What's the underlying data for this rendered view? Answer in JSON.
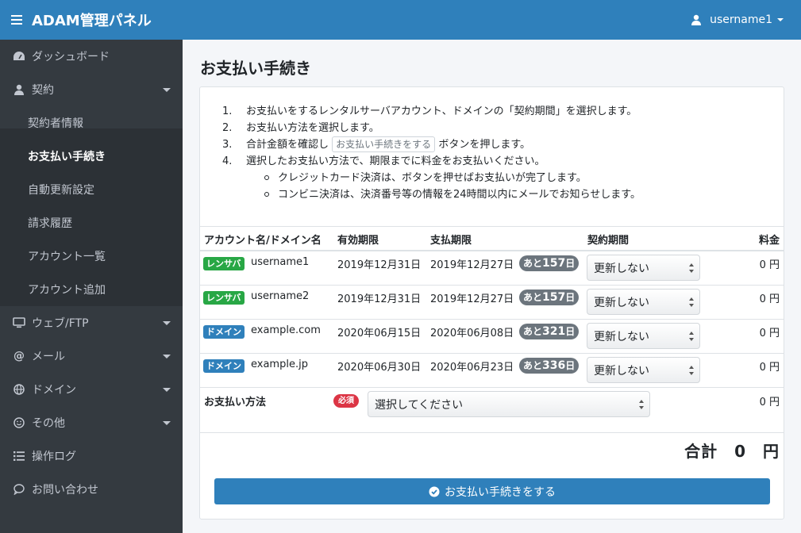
{
  "header": {
    "title": "ADAM管理パネル",
    "username": "username1"
  },
  "sidebar": {
    "items": [
      {
        "label": "ダッシュボード",
        "icon": "dashboard-icon"
      },
      {
        "label": "契約",
        "icon": "user-icon"
      },
      {
        "label": "契約者情報"
      },
      {
        "label": "お支払い手続き"
      },
      {
        "label": "自動更新設定"
      },
      {
        "label": "請求履歴"
      },
      {
        "label": "アカウント一覧"
      },
      {
        "label": "アカウント追加"
      },
      {
        "label": "ウェブ/FTP",
        "icon": "desktop-icon"
      },
      {
        "label": "メール",
        "icon": "at-icon"
      },
      {
        "label": "ドメイン",
        "icon": "globe-icon"
      },
      {
        "label": "その他",
        "icon": "smile-icon"
      },
      {
        "label": "操作ログ",
        "icon": "list-icon"
      },
      {
        "label": "お問い合わせ",
        "icon": "comment-icon"
      }
    ]
  },
  "page": {
    "title": "お支払い手続き"
  },
  "instructions": {
    "s1_num": "1.",
    "s1": "お支払いをするレンタルサーバアカウント、ドメインの「契約期間」を選択します。",
    "s2_num": "2.",
    "s2": "お支払い方法を選択します。",
    "s3_num": "3.",
    "s3_pre": "合計金額を確認し",
    "s3_btn": "お支払い手続きをする",
    "s3_post": "ボタンを押します。",
    "s4_num": "4.",
    "s4": "選択したお支払い方法で、期限までに料金をお支払いください。",
    "s4a": "クレジットカード決済は、ボタンを押せばお支払いが完了します。",
    "s4b": "コンビニ決済は、決済番号等の情報を24時間以内にメールでお知らせします。"
  },
  "table": {
    "headers": {
      "name": "アカウント名/ドメイン名",
      "valid": "有効期限",
      "pay": "支払期限",
      "period": "契約期間",
      "fee": "料金"
    },
    "rows": [
      {
        "type": "レンサバ",
        "name": "username1",
        "valid": "2019年12月31日",
        "pay": "2019年12月27日",
        "left_pre": "あと",
        "left_num": "157",
        "left_post": "日",
        "period": "更新しない",
        "fee": "0 円"
      },
      {
        "type": "レンサバ",
        "name": "username2",
        "valid": "2019年12月31日",
        "pay": "2019年12月27日",
        "left_pre": "あと",
        "left_num": "157",
        "left_post": "日",
        "period": "更新しない",
        "fee": "0 円"
      },
      {
        "type": "ドメイン",
        "name": "example.com",
        "valid": "2020年06月15日",
        "pay": "2020年06月08日",
        "left_pre": "あと",
        "left_num": "321",
        "left_post": "日",
        "period": "更新しない",
        "fee": "0 円"
      },
      {
        "type": "ドメイン",
        "name": "example.jp",
        "valid": "2020年06月30日",
        "pay": "2020年06月23日",
        "left_pre": "あと",
        "left_num": "336",
        "left_post": "日",
        "period": "更新しない",
        "fee": "0 円"
      }
    ],
    "payment_label": "お支払い方法",
    "required": "必須",
    "payment_value": "選択してください",
    "payment_fee": "0 円",
    "total": "合計　0　円"
  },
  "submit": {
    "label": "お支払い手続きをする"
  },
  "colors": {
    "primary": "#2f80bb",
    "sidebar": "#343a40",
    "green": "#28a745",
    "red": "#dc3545"
  }
}
